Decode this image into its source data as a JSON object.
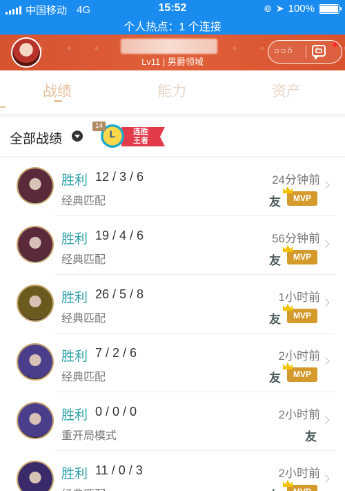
{
  "status_bar": {
    "carrier": "中国移动",
    "network": "4G",
    "time": "15:52",
    "battery": "100%",
    "hotspot": "个人热点：1 个连接"
  },
  "profile": {
    "level": "Lv11 | 男爵领域",
    "more": "○○○"
  },
  "tabs": [
    "战绩",
    "能力",
    "资产"
  ],
  "section": {
    "title": "全部战绩",
    "streak_count": "14",
    "streak_letter": "L",
    "streak_line1": "连胜",
    "streak_line2": "王者"
  },
  "matches": [
    {
      "result": "胜利",
      "kda": "12 / 3 / 6",
      "mode": "经典匹配",
      "time": "24分钟前",
      "friend": "友",
      "mvp": "MVP",
      "hero_color": "#5a2a3a"
    },
    {
      "result": "胜利",
      "kda": "19 / 4 / 6",
      "mode": "经典匹配",
      "time": "56分钟前",
      "friend": "友",
      "mvp": "MVP",
      "hero_color": "#5a2a3a"
    },
    {
      "result": "胜利",
      "kda": "26 / 5 / 8",
      "mode": "经典匹配",
      "time": "1小时前",
      "friend": "友",
      "mvp": "MVP",
      "hero_color": "#6b5a1e"
    },
    {
      "result": "胜利",
      "kda": "7 / 2 / 6",
      "mode": "经典匹配",
      "time": "2小时前",
      "friend": "友",
      "mvp": "MVP",
      "hero_color": "#4a3e8a"
    },
    {
      "result": "胜利",
      "kda": "0 / 0 / 0",
      "mode": "重开局模式",
      "time": "2小时前",
      "friend": "友",
      "mvp": "",
      "hero_color": "#4a3e8a"
    },
    {
      "result": "胜利",
      "kda": "11 / 0 / 3",
      "mode": "经典匹配",
      "time": "2小时前",
      "friend": "友",
      "mvp": "MVP",
      "hero_color": "#3a2a6a"
    }
  ]
}
